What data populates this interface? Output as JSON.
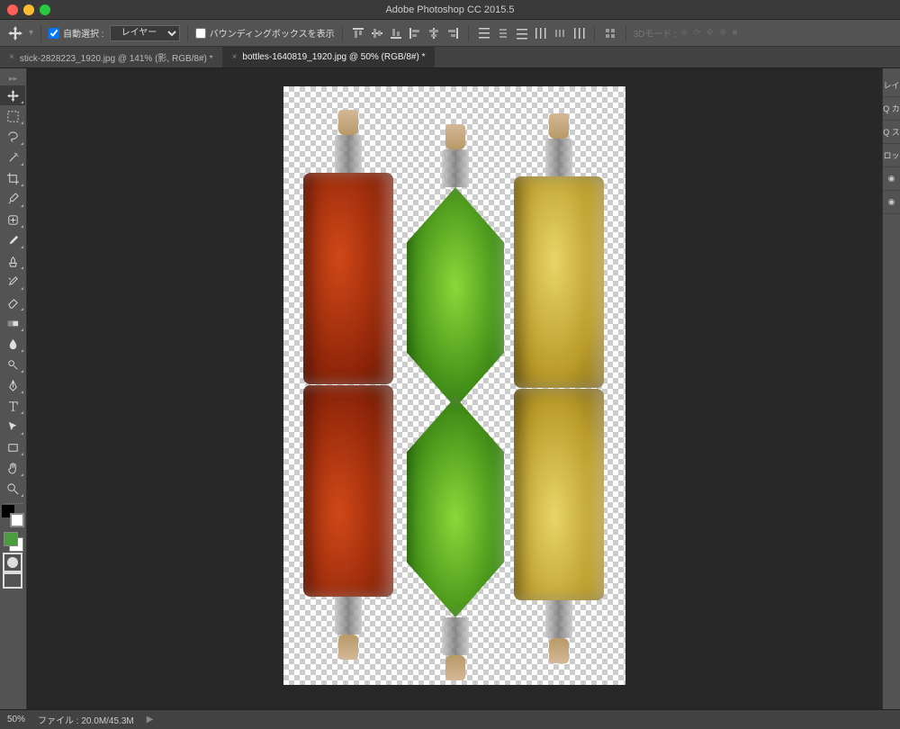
{
  "app": {
    "title": "Adobe Photoshop CC 2015.5"
  },
  "options": {
    "auto_select_label": "自動選択 :",
    "auto_select_value": "レイヤー",
    "show_bbox_label": "バウンディングボックスを表示",
    "mode3d_label": "3Dモード :"
  },
  "tabs": [
    {
      "label": "stick-2828223_1920.jpg @ 141% (影, RGB/8#) *",
      "active": false
    },
    {
      "label": "bottles-1640819_1920.jpg @ 50% (RGB/8#) *",
      "active": true
    }
  ],
  "right_panel": {
    "labels": [
      "レイ",
      "Q カ",
      "Q ス",
      "ロッ"
    ],
    "eyes": 2
  },
  "colors": {
    "foreground": "#4b9b3f",
    "background": "#ffffff"
  },
  "status": {
    "zoom": "50%",
    "file_label": "ファイル :",
    "file_info": "20.0M/45.3M"
  },
  "canvas": {
    "bottles": [
      {
        "color": "red",
        "shape": "rect"
      },
      {
        "color": "green",
        "shape": "diamond"
      },
      {
        "color": "gold",
        "shape": "rect"
      }
    ]
  }
}
